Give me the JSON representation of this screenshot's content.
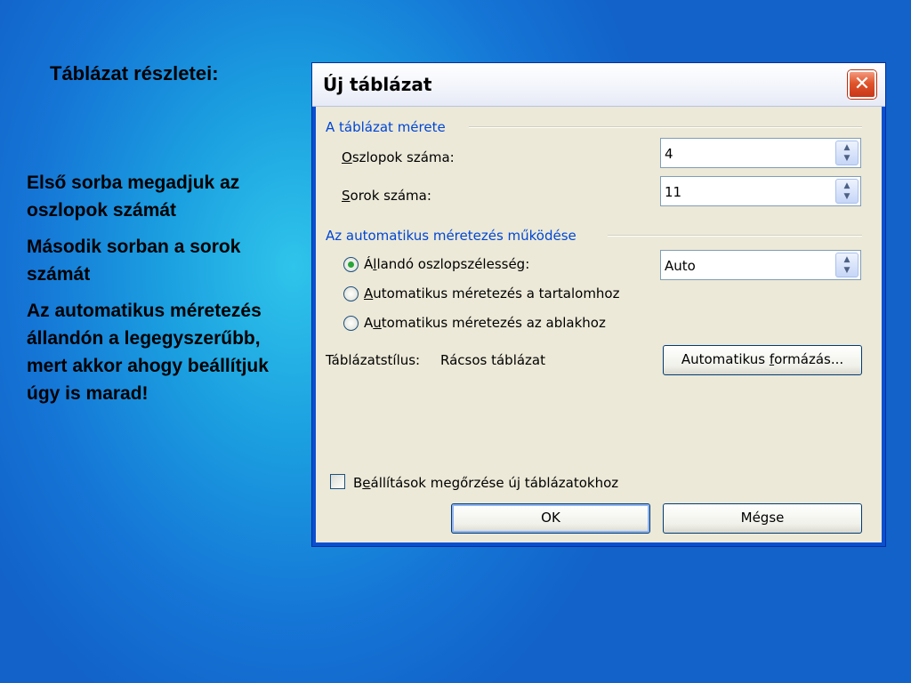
{
  "slide": {
    "title": "Táblázat részletei:",
    "notes": [
      "Első sorba megadjuk az oszlopok számát",
      "Második sorban a sorok számát",
      "Az automatikus méretezés állandón a legegyszerűbb, mert akkor ahogy beállítjuk úgy is marad!"
    ]
  },
  "dialog": {
    "title": "Új táblázat",
    "close_glyph": "✕",
    "size_group": {
      "label": "A táblázat mérete",
      "columns": {
        "label_ul": "O",
        "label_rest": "szlopok száma:",
        "value": "4"
      },
      "rows": {
        "label_ul": "S",
        "label_rest": "orok száma:",
        "value": "11"
      }
    },
    "autofit_group": {
      "label": "Az automatikus méretezés működése",
      "options": [
        {
          "pre": "Á",
          "ul": "l",
          "post": "landó oszlopszélesség:",
          "selected": true
        },
        {
          "pre": "",
          "ul": "A",
          "post": "utomatikus méretezés a tartalomhoz",
          "selected": false
        },
        {
          "pre": "A",
          "ul": "u",
          "post": "tomatikus méretezés az ablakhoz",
          "selected": false
        }
      ],
      "fixed_width_value": "Auto"
    },
    "style": {
      "label": "Táblázatstílus:",
      "value": "Rácsos táblázat",
      "autoformat_pre": "Automatikus ",
      "autoformat_ul": "f",
      "autoformat_post": "ormázás..."
    },
    "remember": {
      "pre": "B",
      "ul": "e",
      "post": "állítások megőrzése új táblázatokhoz",
      "checked": false
    },
    "ok_label": "OK",
    "cancel_label": "Mégse"
  },
  "colors": {
    "group_label": "#0046d5",
    "dialog_face": "#ece9d8",
    "title_border": "#0a4fd0"
  }
}
